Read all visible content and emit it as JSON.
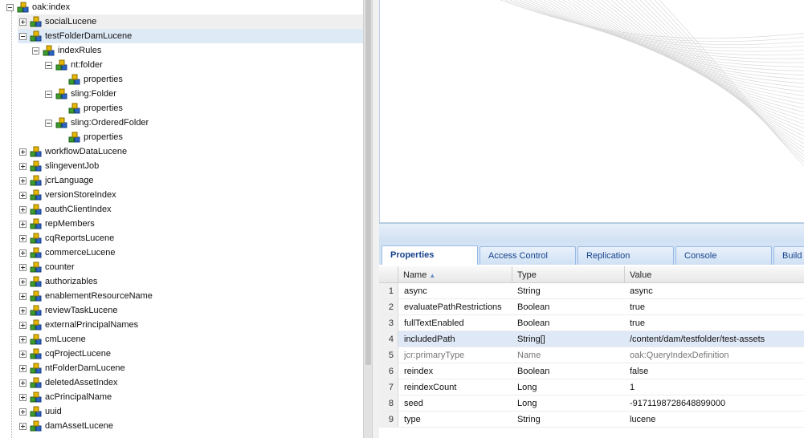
{
  "tree": {
    "root": "oak:index",
    "items": [
      {
        "label": "socialLucene",
        "toggle": "plus",
        "state": "hover"
      },
      {
        "label": "testFolderDamLucene",
        "toggle": "minus",
        "state": "selected"
      },
      {
        "label": "indexRules",
        "toggle": "minus"
      },
      {
        "label": "nt:folder",
        "toggle": "minus"
      },
      {
        "label": "properties",
        "toggle": "none"
      },
      {
        "label": "sling:Folder",
        "toggle": "minus"
      },
      {
        "label": "properties",
        "toggle": "none"
      },
      {
        "label": "sling:OrderedFolder",
        "toggle": "minus"
      },
      {
        "label": "properties",
        "toggle": "none"
      },
      {
        "label": "workflowDataLucene",
        "toggle": "plus"
      },
      {
        "label": "slingeventJob",
        "toggle": "plus"
      },
      {
        "label": "jcrLanguage",
        "toggle": "plus"
      },
      {
        "label": "versionStoreIndex",
        "toggle": "plus"
      },
      {
        "label": "oauthClientIndex",
        "toggle": "plus"
      },
      {
        "label": "repMembers",
        "toggle": "plus"
      },
      {
        "label": "cqReportsLucene",
        "toggle": "plus"
      },
      {
        "label": "commerceLucene",
        "toggle": "plus"
      },
      {
        "label": "counter",
        "toggle": "plus"
      },
      {
        "label": "authorizables",
        "toggle": "plus"
      },
      {
        "label": "enablementResourceName",
        "toggle": "plus"
      },
      {
        "label": "reviewTaskLucene",
        "toggle": "plus"
      },
      {
        "label": "externalPrincipalNames",
        "toggle": "plus"
      },
      {
        "label": "cmLucene",
        "toggle": "plus"
      },
      {
        "label": "cqProjectLucene",
        "toggle": "plus"
      },
      {
        "label": "ntFolderDamLucene",
        "toggle": "plus"
      },
      {
        "label": "deletedAssetIndex",
        "toggle": "plus"
      },
      {
        "label": "acPrincipalName",
        "toggle": "plus"
      },
      {
        "label": "uuid",
        "toggle": "plus"
      },
      {
        "label": "damAssetLucene",
        "toggle": "plus"
      }
    ]
  },
  "tabs": [
    {
      "label": "Properties",
      "active": true
    },
    {
      "label": "Access Control",
      "active": false
    },
    {
      "label": "Replication",
      "active": false
    },
    {
      "label": "Console",
      "active": false
    },
    {
      "label": "Build",
      "active": false
    }
  ],
  "grid": {
    "columns": {
      "name": "Name",
      "sort_indicator": "▲",
      "type": "Type",
      "value": "Value"
    },
    "rows": [
      {
        "num": "1",
        "name": "async",
        "type": "String",
        "value": "async"
      },
      {
        "num": "2",
        "name": "evaluatePathRestrictions",
        "type": "Boolean",
        "value": "true"
      },
      {
        "num": "3",
        "name": "fullTextEnabled",
        "type": "Boolean",
        "value": "true"
      },
      {
        "num": "4",
        "name": "includedPath",
        "type": "String[]",
        "value": "/content/dam/testfolder/test-assets",
        "selected": true
      },
      {
        "num": "5",
        "name": "jcr:primaryType",
        "type": "Name",
        "value": "oak:QueryIndexDefinition",
        "muted": true
      },
      {
        "num": "6",
        "name": "reindex",
        "type": "Boolean",
        "value": "false"
      },
      {
        "num": "7",
        "name": "reindexCount",
        "type": "Long",
        "value": "1"
      },
      {
        "num": "8",
        "name": "seed",
        "type": "Long",
        "value": "-9171198728648899000"
      },
      {
        "num": "9",
        "name": "type",
        "type": "String",
        "value": "lucene"
      }
    ]
  },
  "colors": {
    "accent": "#15428b",
    "selected_row": "#dfe8f6",
    "tree_selected": "#dfeaf7"
  }
}
